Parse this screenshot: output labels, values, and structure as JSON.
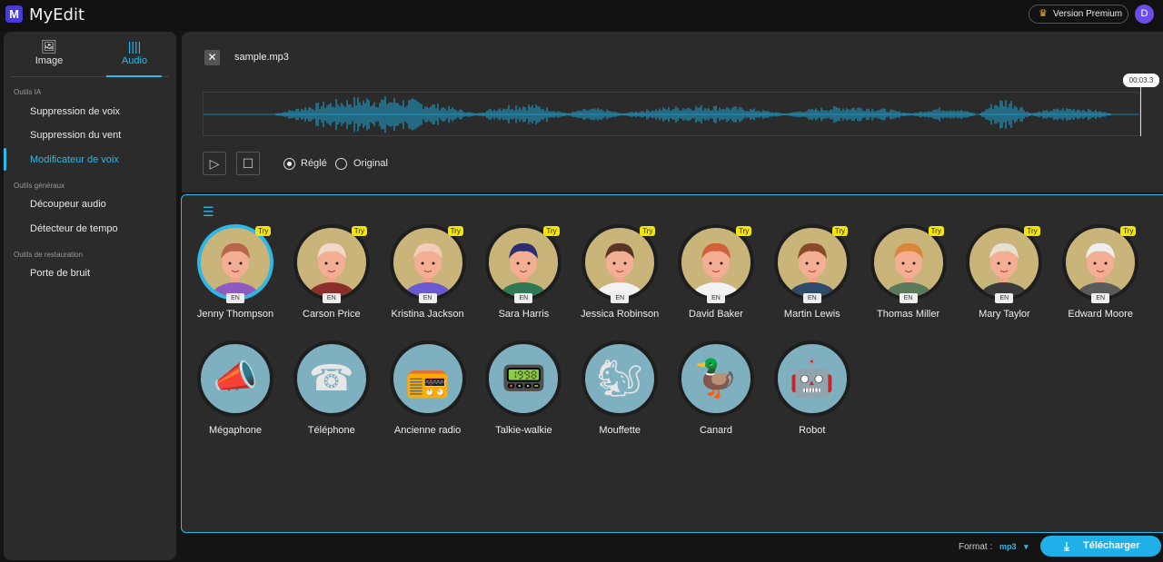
{
  "app": {
    "logo": "M",
    "title": "MyEdit",
    "premium_label": "Version Premium",
    "user_initial": "D"
  },
  "sidebar": {
    "tabs": [
      {
        "label": "Image",
        "icon": "image-icon"
      },
      {
        "label": "Audio",
        "icon": "waveform-icon"
      }
    ],
    "sections": [
      {
        "title": "Outils IA",
        "items": [
          "Suppression de voix",
          "Suppression du vent",
          "Modificateur de voix"
        ]
      },
      {
        "title": "Outils généraux",
        "items": [
          "Découpeur audio",
          "Détecteur de tempo"
        ]
      },
      {
        "title": "Outils de restauration",
        "items": [
          "Porte de bruit"
        ]
      }
    ],
    "active_item": "Modificateur de voix"
  },
  "player": {
    "file_name": "sample.mp3",
    "time": "00:03.3",
    "modes": [
      "Réglé",
      "Original"
    ],
    "selected_mode": "Réglé",
    "accent": "#2eb8e6"
  },
  "voices": [
    {
      "name": "Jenny Thompson",
      "lang": "EN",
      "badge": "Try",
      "bg": "#c9b47a",
      "hair": "#b8674a",
      "shirt": "#8e5bc2"
    },
    {
      "name": "Carson Price",
      "lang": "EN",
      "badge": "Try",
      "bg": "#c9b47a",
      "hair": "#f2d8c6",
      "shirt": "#8a2f2a"
    },
    {
      "name": "Kristina Jackson",
      "lang": "EN",
      "badge": "Try",
      "bg": "#c9b47a",
      "hair": "#f1cdb8",
      "shirt": "#6a5ad0"
    },
    {
      "name": "Sara Harris",
      "lang": "EN",
      "badge": "Try",
      "bg": "#c9b47a",
      "hair": "#2c2e6e",
      "shirt": "#2f7a55"
    },
    {
      "name": "Jessica Robinson",
      "lang": "EN",
      "badge": "Try",
      "bg": "#c9b47a",
      "hair": "#5a3525",
      "shirt": "#f2f2f2"
    },
    {
      "name": "David Baker",
      "lang": "EN",
      "badge": "Try",
      "bg": "#c9b47a",
      "hair": "#d2603a",
      "shirt": "#f2f2f2"
    },
    {
      "name": "Martin Lewis",
      "lang": "EN",
      "badge": "Try",
      "bg": "#c9b47a",
      "hair": "#8a4a2a",
      "shirt": "#2f4a6a"
    },
    {
      "name": "Thomas Miller",
      "lang": "EN",
      "badge": "Try",
      "bg": "#c9b47a",
      "hair": "#d9873a",
      "shirt": "#5a7a5a"
    },
    {
      "name": "Mary Taylor",
      "lang": "EN",
      "badge": "Try",
      "bg": "#c9b47a",
      "hair": "#e8e0d0",
      "shirt": "#3a3a3a"
    },
    {
      "name": "Edward Moore",
      "lang": "EN",
      "badge": "Try",
      "bg": "#c9b47a",
      "hair": "#eeeeee",
      "shirt": "#5a5a5a"
    }
  ],
  "effects": [
    {
      "name": "Mégaphone",
      "emoji": "📣"
    },
    {
      "name": "Téléphone",
      "emoji": "☎"
    },
    {
      "name": "Ancienne radio",
      "emoji": "📻"
    },
    {
      "name": "Talkie-walkie",
      "emoji": "📟"
    },
    {
      "name": "Mouffette",
      "emoji": "🐿"
    },
    {
      "name": "Canard",
      "emoji": "🦆"
    },
    {
      "name": "Robot",
      "emoji": "🤖"
    }
  ],
  "footer": {
    "format_label": "Format :",
    "format_value": "mp3",
    "download_label": "Télécharger"
  }
}
